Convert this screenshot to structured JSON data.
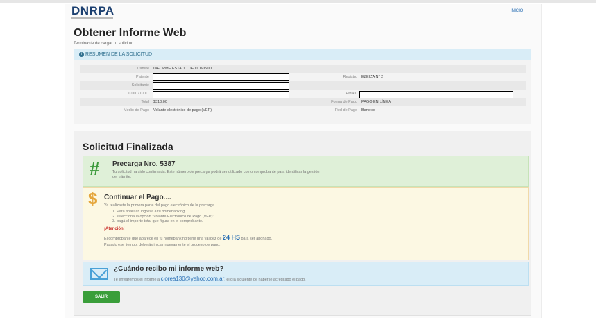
{
  "header": {
    "logo": "DNRPA",
    "inicio": "INICIO"
  },
  "page": {
    "title": "Obtener Informe Web",
    "subtitle": "Terminaste de cargar tu solicitud."
  },
  "resumen": {
    "title": "RESUMEN DE LA SOLICITUD",
    "tramite_label": "Trámite",
    "tramite_value": "INFORME ESTADO DE DOMINIO",
    "patente_label": "Patente",
    "registro_label": "Registro",
    "registro_value": "EZEIZA N° 2",
    "solicitante_label": "Solicitante",
    "cuil_label": "CUIL / CUIT",
    "email_label": "EMAIL",
    "total_label": "Total",
    "total_value": "$310,00",
    "forma_label": "Forma de Pago",
    "forma_value": "PAGO EN LÍNEA",
    "medio_label": "Medio de Pago",
    "medio_value": "Volante electrónico de pago (VEP)",
    "red_label": "Red de Pago",
    "red_value": "Banelco"
  },
  "final": {
    "title": "Solicitud Finalizada",
    "precarga_title": "Precarga Nro. 5387",
    "precarga_text1": "Tu solicitud ha sido confirmada. Este número de precarga podrá ser utilizado como comprobante para identificar la gestión",
    "precarga_text2": "del trámite.",
    "pago_title": "Continuar el Pago....",
    "pago_intro": "Ya realizaste la primera parte del pago electrónico de la precarga.",
    "pago_step1": "1. Para finalizar, ingresá a tu homebanking.",
    "pago_step2": "2. seleccioná la opción \"Volante Electrónico de Pago (VEP)\"",
    "pago_step3": "3. pagá el importe total que figura en el comprobante.",
    "atencion": "¡Atención!",
    "validez_text": "El comprobante que aparece en tu homebanking tiene una validez de",
    "validez_value": "24 HS",
    "validez_suffix": "para ser abonado.",
    "validez_text2": "Pasado ese tiempo, deberás iniciar nuevamente el proceso de pago.",
    "informe_title": "¿Cuándo recibo mi informe web?",
    "informe_text": "Te enviaremos el informe a",
    "informe_email": "clorea130@yahoo.com.ar",
    "informe_suffix": ", el día siguiente de haberse acreditado el pago.",
    "salir": "SALIR"
  },
  "colors": {
    "brand": "#1b3f70",
    "success": "#3c9a3c",
    "warning": "#e4a53a",
    "info": "#4aa1d6"
  },
  "icons": {
    "hash": "hash-icon",
    "dollar": "dollar-icon",
    "envelope": "envelope-icon",
    "info": "info-icon"
  }
}
